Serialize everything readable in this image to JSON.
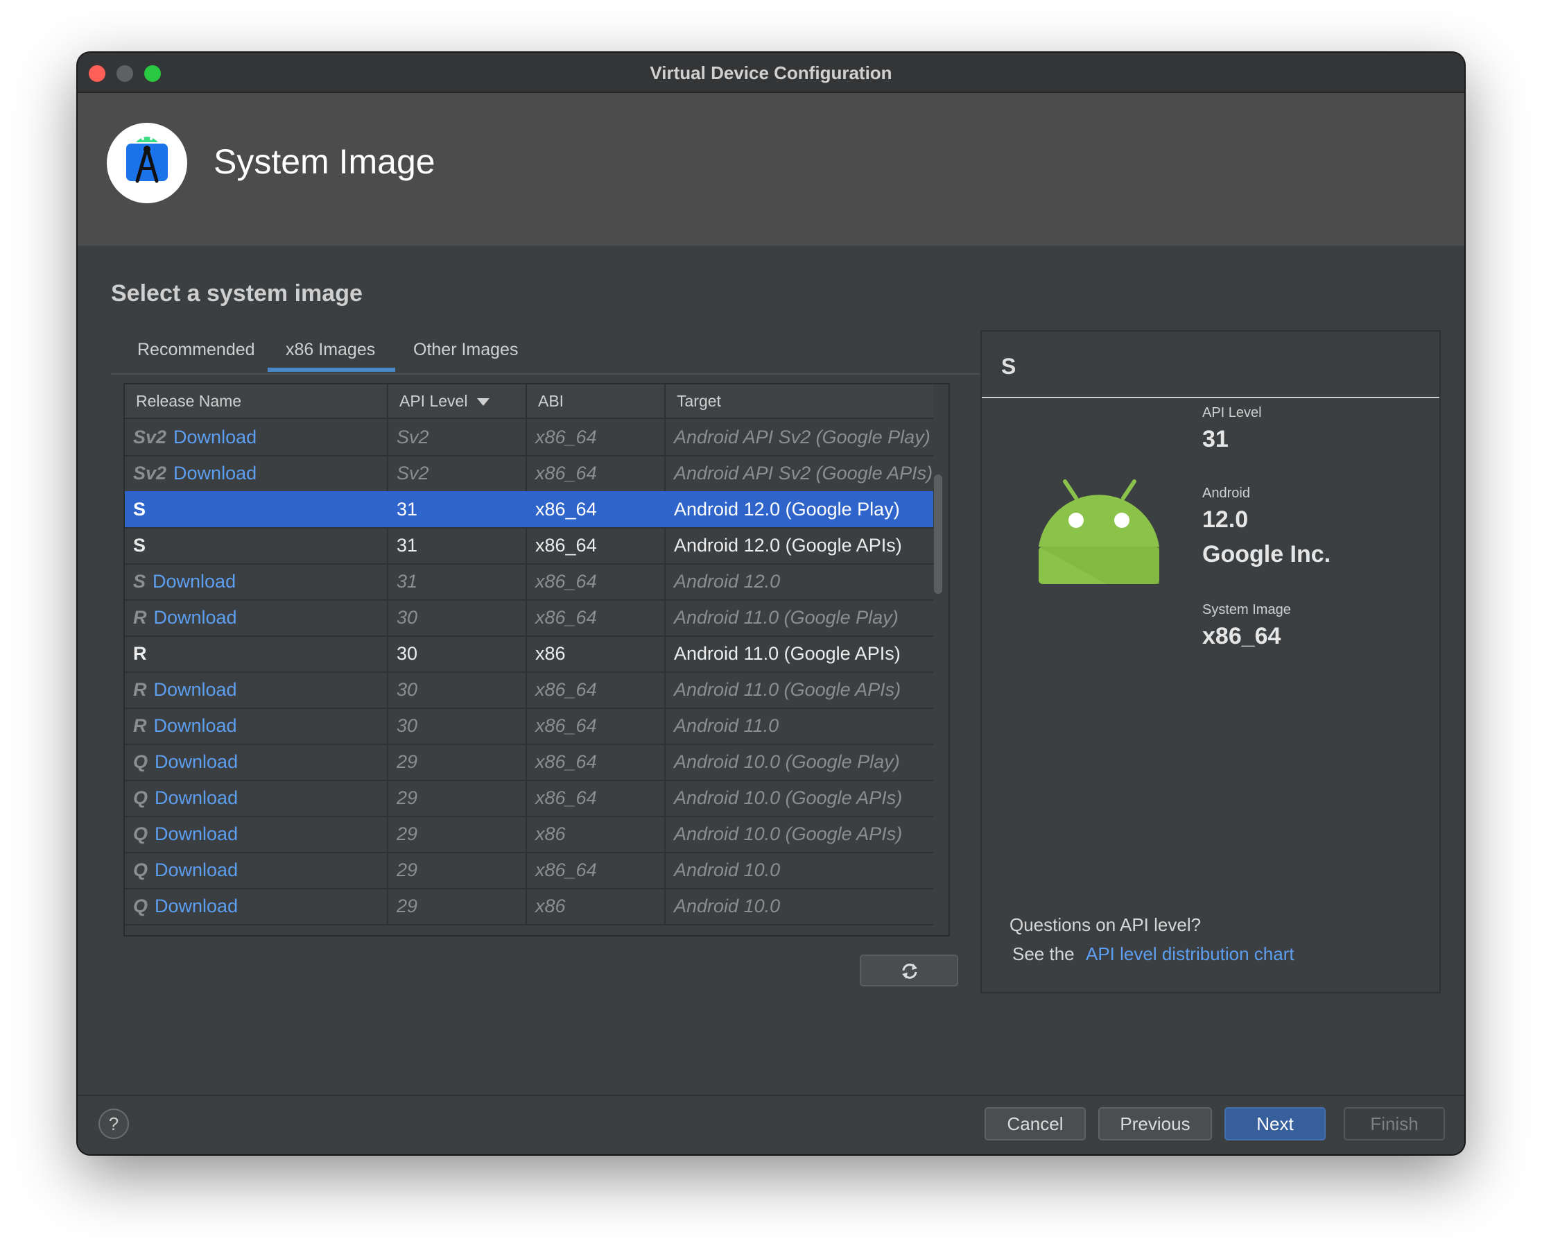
{
  "window": {
    "title": "Virtual Device Configuration"
  },
  "header": {
    "title": "System Image"
  },
  "section_title": "Select a system image",
  "tabs": [
    {
      "label": "Recommended",
      "active": false
    },
    {
      "label": "x86 Images",
      "active": true
    },
    {
      "label": "Other Images",
      "active": false
    }
  ],
  "table": {
    "columns": [
      "Release Name",
      "API Level",
      "ABI",
      "Target"
    ],
    "sort_column": "API Level",
    "sort_direction": "descending",
    "download_label": "Download",
    "rows": [
      {
        "name": "Sv2",
        "download": true,
        "api": "Sv2",
        "abi": "x86_64",
        "target": "Android API Sv2 (Google Play)"
      },
      {
        "name": "Sv2",
        "download": true,
        "api": "Sv2",
        "abi": "x86_64",
        "target": "Android API Sv2 (Google APIs)"
      },
      {
        "name": "S",
        "download": false,
        "selected": true,
        "api": "31",
        "abi": "x86_64",
        "target": "Android 12.0 (Google Play)"
      },
      {
        "name": "S",
        "download": false,
        "api": "31",
        "abi": "x86_64",
        "target": "Android 12.0 (Google APIs)"
      },
      {
        "name": "S",
        "download": true,
        "api": "31",
        "abi": "x86_64",
        "target": "Android 12.0"
      },
      {
        "name": "R",
        "download": true,
        "api": "30",
        "abi": "x86_64",
        "target": "Android 11.0 (Google Play)"
      },
      {
        "name": "R",
        "download": false,
        "api": "30",
        "abi": "x86",
        "target": "Android 11.0 (Google APIs)"
      },
      {
        "name": "R",
        "download": true,
        "api": "30",
        "abi": "x86_64",
        "target": "Android 11.0 (Google APIs)"
      },
      {
        "name": "R",
        "download": true,
        "api": "30",
        "abi": "x86_64",
        "target": "Android 11.0"
      },
      {
        "name": "Q",
        "download": true,
        "api": "29",
        "abi": "x86_64",
        "target": "Android 10.0 (Google Play)"
      },
      {
        "name": "Q",
        "download": true,
        "api": "29",
        "abi": "x86_64",
        "target": "Android 10.0 (Google APIs)"
      },
      {
        "name": "Q",
        "download": true,
        "api": "29",
        "abi": "x86",
        "target": "Android 10.0 (Google APIs)"
      },
      {
        "name": "Q",
        "download": true,
        "api": "29",
        "abi": "x86_64",
        "target": "Android 10.0"
      },
      {
        "name": "Q",
        "download": true,
        "api": "29",
        "abi": "x86",
        "target": "Android 10.0"
      }
    ]
  },
  "detail": {
    "name": "S",
    "api_level_label": "API Level",
    "api_level": "31",
    "android_label": "Android",
    "android_version": "12.0",
    "vendor": "Google Inc.",
    "system_image_label": "System Image",
    "system_image": "x86_64",
    "questions": "Questions on API level?",
    "see_the": "See the",
    "link": "API level distribution chart"
  },
  "buttons": {
    "help": "?",
    "cancel": "Cancel",
    "previous": "Previous",
    "next": "Next",
    "finish": "Finish"
  },
  "colors": {
    "accent": "#4a88c7",
    "selection": "#2f65ca",
    "link": "#5c9ef0",
    "android_green": "#8bc34a",
    "background": "#3c3f41"
  },
  "icons": {
    "logo": "android-studio-logo-icon",
    "refresh": "refresh-icon",
    "android": "android-robot-icon",
    "sort": "sort-descending-icon"
  }
}
